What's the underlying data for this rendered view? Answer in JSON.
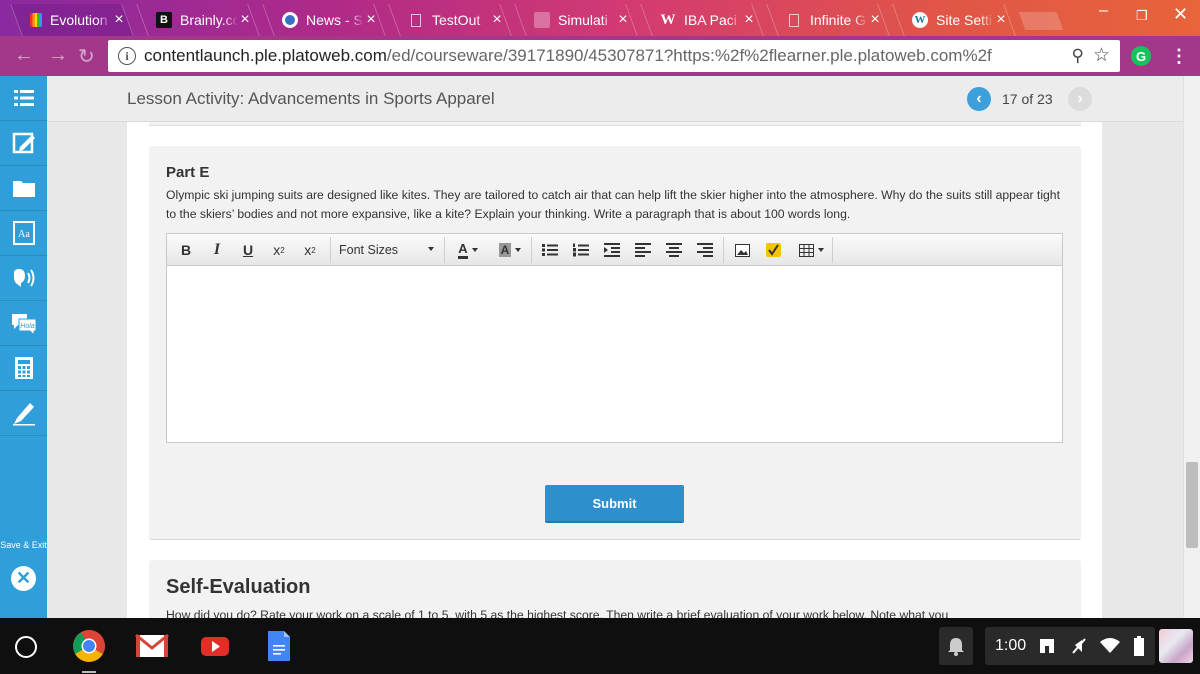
{
  "browser": {
    "tabs": [
      {
        "title": "Evolution",
        "favicon": "rainbow-icon",
        "active": true
      },
      {
        "title": "Brainly.com",
        "favicon": "brainly-icon",
        "active": false
      },
      {
        "title": "News - S",
        "favicon": "news-icon",
        "active": false
      },
      {
        "title": "TestOut",
        "favicon": "page-icon",
        "active": false
      },
      {
        "title": "Simulati",
        "favicon": "simulation-icon",
        "active": false
      },
      {
        "title": "IBA Paci",
        "favicon": "w-icon",
        "active": false
      },
      {
        "title": "Infinite G",
        "favicon": "page-icon",
        "active": false
      },
      {
        "title": "Site Setti",
        "favicon": "wordpress-icon",
        "active": false
      }
    ],
    "tab_close_glyph": "×",
    "url_host": "contentlaunch.ple.platoweb.com",
    "url_path": "/ed/courseware/39171890/45307871?https:%2f%2flearner.ple.platoweb.com%2f",
    "extension_letter": "G"
  },
  "sidebar": {
    "save_exit_label": "Save & Exit",
    "items": [
      "menu-icon",
      "edit-icon",
      "folder-icon",
      "dictionary-icon",
      "audio-icon",
      "translate-icon",
      "calculator-icon",
      "pen-icon"
    ],
    "translate_label": "Hola",
    "dictionary_label": "Aa"
  },
  "header": {
    "lesson_title": "Lesson Activity: Advancements in Sports Apparel",
    "pager": "17 of 23"
  },
  "question": {
    "part_title": "Part E",
    "text": "Olympic ski jumping suits are designed like kites. They are tailored to catch air that can help lift the skier higher into the atmosphere. Why do the suits still appear tight to the skiers’ bodies and not more expansive, like a kite? Explain your thinking. Write a paragraph that is about 100 words long."
  },
  "editor": {
    "bold": "B",
    "italic": "I",
    "underline": "U",
    "superscript": "x",
    "subscript": "x",
    "font_sizes": "Font Sizes",
    "font_color": "A",
    "highlight_color": "A",
    "value": ""
  },
  "submit_label": "Submit",
  "self_evaluation": {
    "title": "Self-Evaluation",
    "text": "How did you do? Rate your work on a scale of 1 to 5, with 5 as the highest score. Then write a brief evaluation of your work below. Note what you"
  },
  "shelf": {
    "time": "1:00",
    "apps": [
      "chrome-icon",
      "gmail-icon",
      "youtube-icon",
      "docs-icon"
    ]
  },
  "colors": {
    "sidebar": "#2e9fd8",
    "submit": "#2d8fcb",
    "tabbar_start": "#8a2aa0",
    "tabbar_end": "#e8643a"
  }
}
